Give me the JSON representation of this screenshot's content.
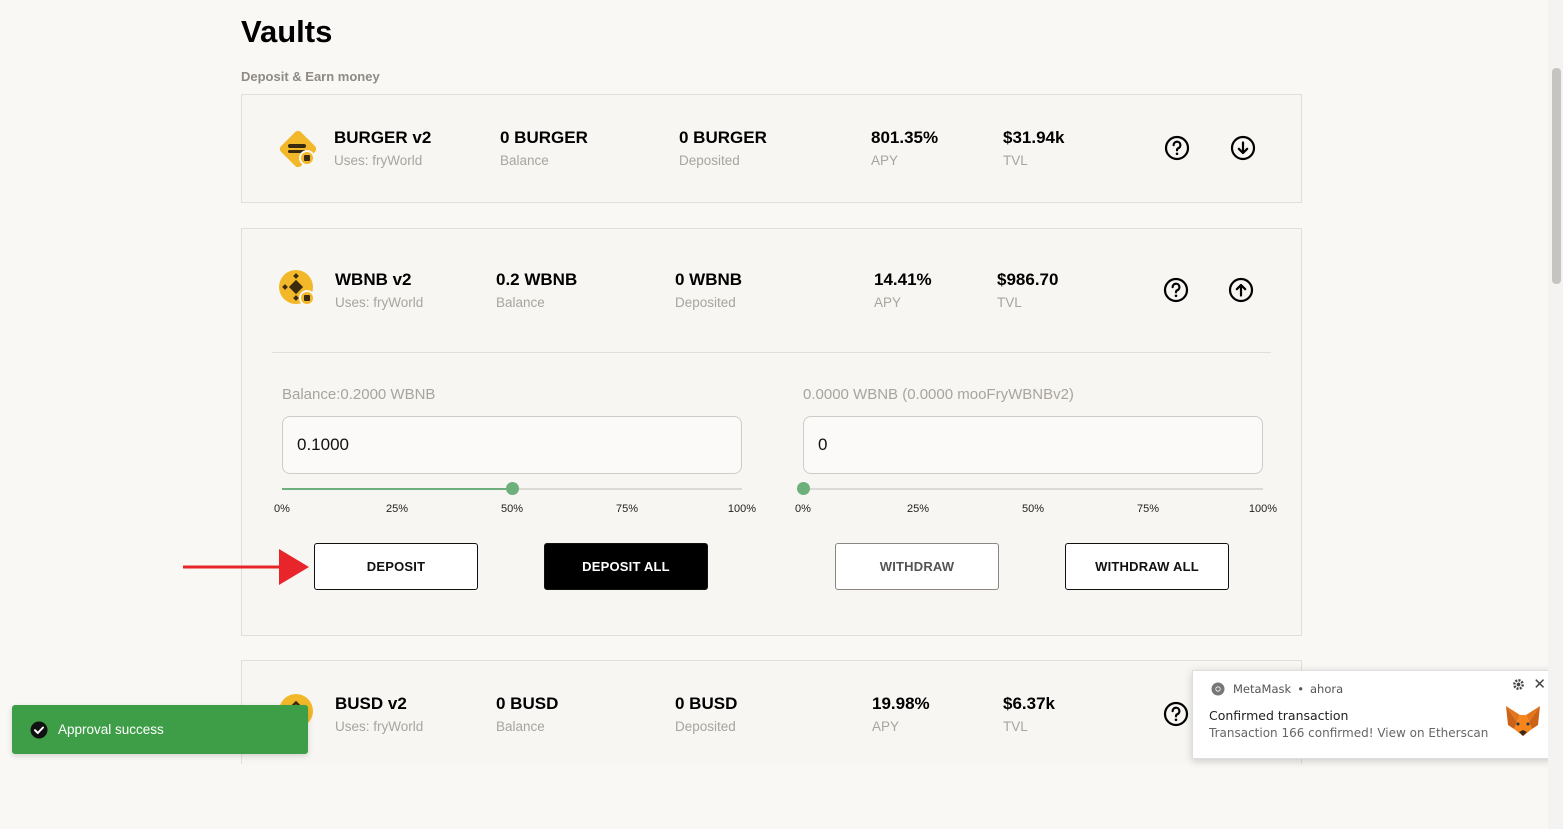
{
  "page": {
    "title": "Vaults",
    "subtitle": "Deposit & Earn money"
  },
  "vaults": [
    {
      "name": "BURGER v2",
      "uses": "Uses: fryWorld",
      "balance": "0 BURGER",
      "balance_label": "Balance",
      "deposited": "0 BURGER",
      "deposited_label": "Deposited",
      "apy": "801.35%",
      "apy_label": "APY",
      "tvl": "$31.94k",
      "tvl_label": "TVL",
      "toggle_icon": "arrow-down-circle-icon"
    },
    {
      "name": "WBNB v2",
      "uses": "Uses: fryWorld",
      "balance": "0.2 WBNB",
      "balance_label": "Balance",
      "deposited": "0 WBNB",
      "deposited_label": "Deposited",
      "apy": "14.41%",
      "apy_label": "APY",
      "tvl": "$986.70",
      "tvl_label": "TVL",
      "toggle_icon": "arrow-up-circle-icon",
      "expanded": {
        "deposit_label": "Balance:0.2000 WBNB",
        "deposit_value": "0.1000",
        "deposit_slider": 0.5,
        "withdraw_label": "0.0000 WBNB (0.0000 mooFryWBNBv2)",
        "withdraw_value": "0",
        "withdraw_slider": 0,
        "ticks": [
          "0%",
          "25%",
          "50%",
          "75%",
          "100%"
        ],
        "deposit_button": "DEPOSIT",
        "deposit_all_button": "DEPOSIT ALL",
        "withdraw_button": "WITHDRAW",
        "withdraw_all_button": "WITHDRAW ALL"
      }
    },
    {
      "name": "BUSD v2",
      "uses": "Uses: fryWorld",
      "balance": "0 BUSD",
      "balance_label": "Balance",
      "deposited": "0 BUSD",
      "deposited_label": "Deposited",
      "apy": "19.98%",
      "apy_label": "APY",
      "tvl": "$6.37k",
      "tvl_label": "TVL"
    }
  ],
  "toast": {
    "message": "Approval success",
    "color": "#3e9e48"
  },
  "notification": {
    "app": "MetaMask",
    "time": "ahora",
    "title": "Confirmed transaction",
    "message": "Transaction 166 confirmed! View on Etherscan"
  },
  "colors": {
    "accent_green": "#6db07c",
    "annotation_arrow": "#e8252a"
  }
}
